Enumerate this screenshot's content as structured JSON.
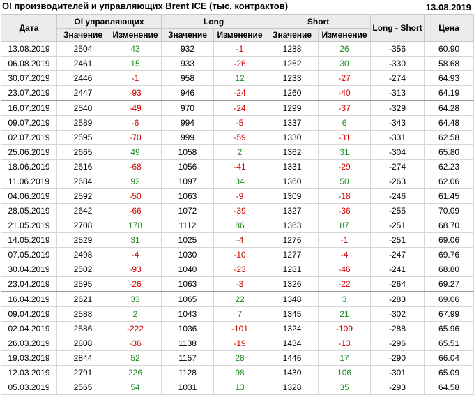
{
  "title": "OI производителей и управляющих Brent ICE (тыс. контрактов)",
  "report_date": "13.08.2019",
  "headers": {
    "date": "Дата",
    "oi": "OI управляющих",
    "long": "Long",
    "short": "Short",
    "long_short": "Long - Short",
    "price": "Цена",
    "value": "Значение",
    "change": "Изменение"
  },
  "colors": {
    "positive": "#1e8a1e",
    "negative": "#d10000",
    "header_bg": "#ececec"
  },
  "rows": [
    [
      "13.08.2019",
      "2504",
      "43",
      "932",
      "-1",
      "1288",
      "26",
      "-356",
      "60.90"
    ],
    [
      "06.08.2019",
      "2461",
      "15",
      "933",
      "-26",
      "1262",
      "30",
      "-330",
      "58.68"
    ],
    [
      "30.07.2019",
      "2446",
      "-1",
      "958",
      "12",
      "1233",
      "-27",
      "-274",
      "64.93"
    ],
    [
      "23.07.2019",
      "2447",
      "-93",
      "946",
      "-24",
      "1260",
      "-40",
      "-313",
      "64.19"
    ],
    [
      "16.07.2019",
      "2540",
      "-49",
      "970",
      "-24",
      "1299",
      "-37",
      "-329",
      "64.28"
    ],
    [
      "09.07.2019",
      "2589",
      "-6",
      "994",
      "-5",
      "1337",
      "6",
      "-343",
      "64.48"
    ],
    [
      "02.07.2019",
      "2595",
      "-70",
      "999",
      "-59",
      "1330",
      "-31",
      "-331",
      "62.58"
    ],
    [
      "25.06.2019",
      "2665",
      "49",
      "1058",
      "2",
      "1362",
      "31",
      "-304",
      "65.80"
    ],
    [
      "18.06.2019",
      "2616",
      "-68",
      "1056",
      "-41",
      "1331",
      "-29",
      "-274",
      "62.23"
    ],
    [
      "11.06.2019",
      "2684",
      "92",
      "1097",
      "34",
      "1360",
      "50",
      "-263",
      "62.06"
    ],
    [
      "04.06.2019",
      "2592",
      "-50",
      "1063",
      "-9",
      "1309",
      "-18",
      "-246",
      "61.45"
    ],
    [
      "28.05.2019",
      "2642",
      "-66",
      "1072",
      "-39",
      "1327",
      "-36",
      "-255",
      "70.09"
    ],
    [
      "21.05.2019",
      "2708",
      "178",
      "1112",
      "86",
      "1363",
      "87",
      "-251",
      "68.70"
    ],
    [
      "14.05.2019",
      "2529",
      "31",
      "1025",
      "-4",
      "1276",
      "-1",
      "-251",
      "69.06"
    ],
    [
      "07.05.2019",
      "2498",
      "-4",
      "1030",
      "-10",
      "1277",
      "-4",
      "-247",
      "69.76"
    ],
    [
      "30.04.2019",
      "2502",
      "-93",
      "1040",
      "-23",
      "1281",
      "-46",
      "-241",
      "68.80"
    ],
    [
      "23.04.2019",
      "2595",
      "-26",
      "1063",
      "-3",
      "1326",
      "-22",
      "-264",
      "69.27"
    ],
    [
      "16.04.2019",
      "2621",
      "33",
      "1065",
      "22",
      "1348",
      "3",
      "-283",
      "69.06"
    ],
    [
      "09.04.2019",
      "2588",
      "2",
      "1043",
      "7",
      "1345",
      "21",
      "-302",
      "67.99"
    ],
    [
      "02.04.2019",
      "2586",
      "-222",
      "1036",
      "-101",
      "1324",
      "-109",
      "-288",
      "65.96"
    ],
    [
      "26.03.2019",
      "2808",
      "-36",
      "1138",
      "-19",
      "1434",
      "-13",
      "-296",
      "65.51"
    ],
    [
      "19.03.2019",
      "2844",
      "52",
      "1157",
      "28",
      "1446",
      "17",
      "-290",
      "66.04"
    ],
    [
      "12.03.2019",
      "2791",
      "226",
      "1128",
      "98",
      "1430",
      "106",
      "-301",
      "65.09"
    ],
    [
      "05.03.2019",
      "2565",
      "54",
      "1031",
      "13",
      "1328",
      "35",
      "-293",
      "64.58"
    ]
  ]
}
